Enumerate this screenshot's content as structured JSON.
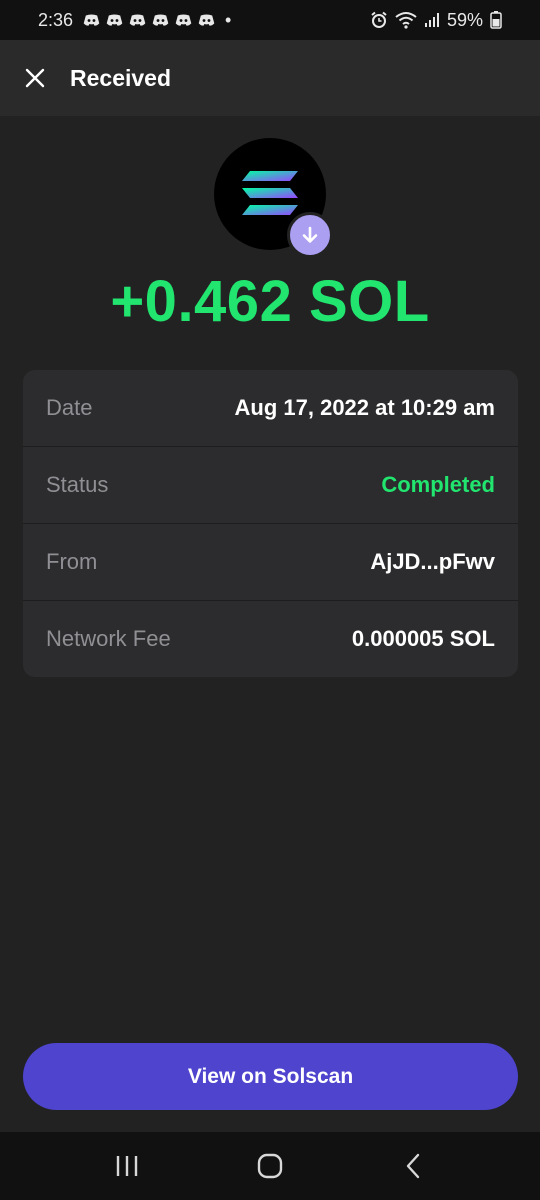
{
  "status_bar": {
    "time": "2:36",
    "notification_icons": [
      "discord-icon",
      "discord-icon",
      "discord-icon",
      "discord-icon",
      "discord-icon",
      "discord-icon"
    ],
    "dot": "•",
    "battery_text": "59%"
  },
  "header": {
    "title": "Received",
    "close_icon": "close-icon"
  },
  "token": {
    "logo": "solana-logo",
    "badge_icon": "arrow-down-icon",
    "badge_color": "#ab9ff2"
  },
  "amount": "+0.462 SOL",
  "details": {
    "rows": [
      {
        "label": "Date",
        "value": "Aug 17, 2022 at 10:29 am"
      },
      {
        "label": "Status",
        "value": "Completed"
      },
      {
        "label": "From",
        "value": "AjJD...pFwv"
      },
      {
        "label": "Network Fee",
        "value": "0.000005 SOL"
      }
    ]
  },
  "action_button": {
    "label": "View on Solscan",
    "color": "#4e44ce"
  },
  "colors": {
    "positive": "#21e56f",
    "background": "#222222",
    "card": "#2c2c2e"
  },
  "nav_bar": {
    "icons": [
      "recent-apps-icon",
      "home-icon",
      "back-icon"
    ]
  }
}
